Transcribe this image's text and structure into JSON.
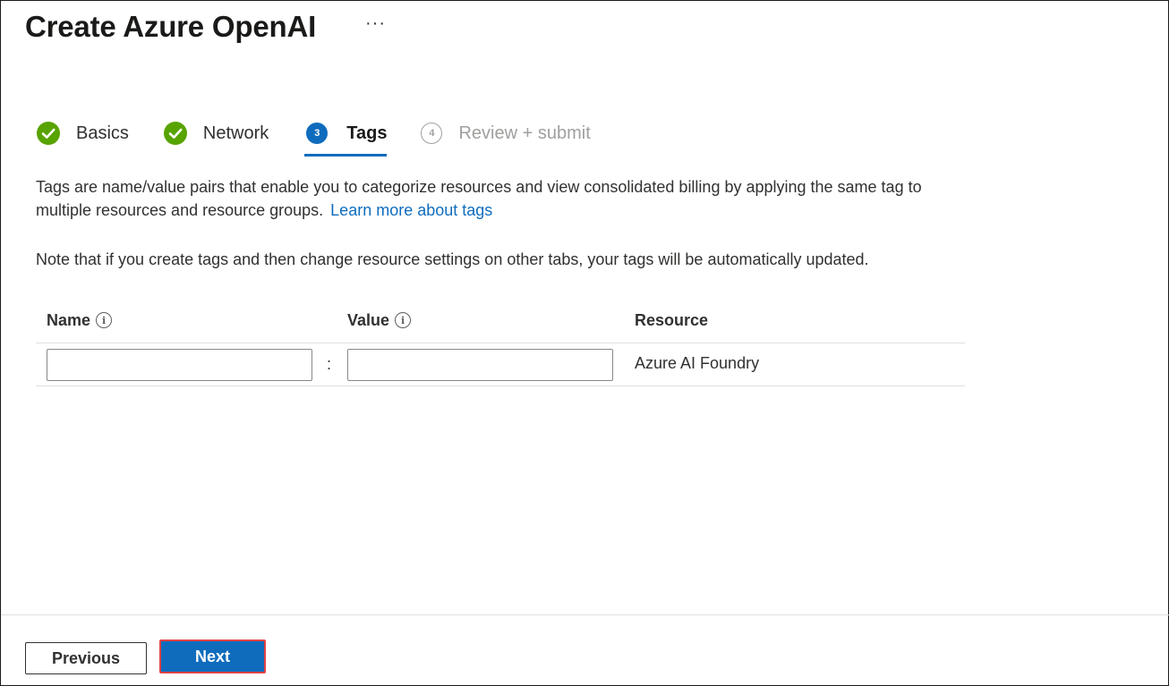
{
  "header": {
    "title": "Create Azure OpenAI",
    "more_label": "···"
  },
  "wizard": {
    "steps": [
      {
        "label": "Basics",
        "state": "completed",
        "icon": "check-circle-icon"
      },
      {
        "label": "Network",
        "state": "completed",
        "icon": "check-circle-icon"
      },
      {
        "label": "Tags",
        "number": "3",
        "state": "active"
      },
      {
        "label": "Review + submit",
        "number": "4",
        "state": "disabled"
      }
    ]
  },
  "content": {
    "description": "Tags are name/value pairs that enable you to categorize resources and view consolidated billing by applying the same tag to multiple resources and resource groups.",
    "learn_more_link": "Learn more about tags",
    "note": "Note that if you create tags and then change resource settings on other tabs, your tags will be automatically updated."
  },
  "tags_table": {
    "columns": {
      "name": "Name",
      "value": "Value",
      "resource": "Resource"
    },
    "info_glyph": "i",
    "rows": [
      {
        "name": "",
        "separator": ":",
        "value": "",
        "resource": "Azure AI Foundry"
      }
    ]
  },
  "footer": {
    "previous_label": "Previous",
    "next_label": "Next"
  },
  "colors": {
    "accent": "#0f6cbd",
    "success": "#57a300",
    "highlight_border": "#e04343",
    "disabled_text": "#a19f9d"
  }
}
